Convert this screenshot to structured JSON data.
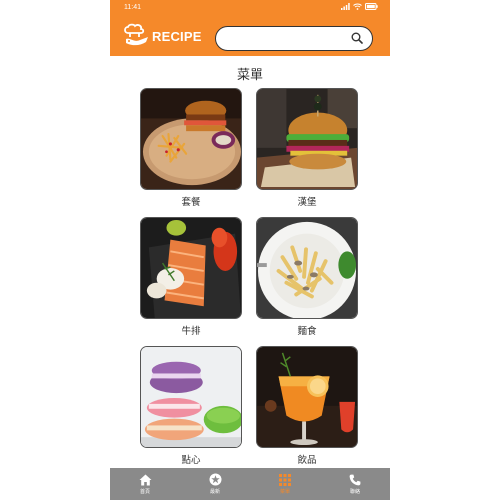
{
  "status": {
    "time": "11:41"
  },
  "header": {
    "logo_text": "RECIPE",
    "search_placeholder": "",
    "search_value": ""
  },
  "main": {
    "title": "菜單",
    "categories": [
      {
        "label": "套餐"
      },
      {
        "label": "漢堡"
      },
      {
        "label": "牛排"
      },
      {
        "label": "麵食"
      },
      {
        "label": "點心"
      },
      {
        "label": "飲品"
      }
    ]
  },
  "tabbar": {
    "items": [
      {
        "label": "首頁",
        "icon": "home-icon"
      },
      {
        "label": "最新",
        "icon": "star-icon"
      },
      {
        "label": "菜單",
        "icon": "grid-icon",
        "active": true
      },
      {
        "label": "聯絡",
        "icon": "phone-icon"
      }
    ]
  },
  "colors": {
    "brand": "#f5892a",
    "tabbar": "#8a8a8a"
  }
}
